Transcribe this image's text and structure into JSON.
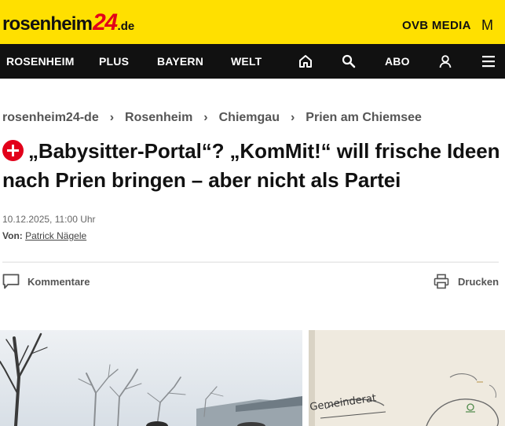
{
  "brand": {
    "logo_main": "rosenheim",
    "logo_number": "24",
    "logo_tld": ".de",
    "partner": "OVB MEDIA",
    "partner_mark": "M",
    "yellow": "#ffe000",
    "red": "#e2001a"
  },
  "nav": {
    "items": [
      {
        "label": "ROSENHEIM"
      },
      {
        "label": "PLUS"
      },
      {
        "label": "BAYERN"
      },
      {
        "label": "WELT"
      }
    ],
    "abo_label": "ABO",
    "icons": [
      "home-icon",
      "search-icon",
      "user-icon",
      "menu-icon"
    ]
  },
  "breadcrumb": [
    {
      "label": "rosenheim24-de"
    },
    {
      "label": "Rosenheim"
    },
    {
      "label": "Chiemgau"
    },
    {
      "label": "Prien am Chiemsee"
    }
  ],
  "article": {
    "headline": "„Babysitter-Portal“? „KomMit!“ will frische Ideen nach Prien bringen – aber nicht als Partei",
    "date": "10.12.2025, 11:00 Uhr",
    "by_label": "Von:",
    "author": "Patrick Nägele"
  },
  "actions": {
    "comments_label": "Kommentare",
    "print_label": "Drucken"
  },
  "images": {
    "right_handwriting": "Gemeinderat"
  }
}
